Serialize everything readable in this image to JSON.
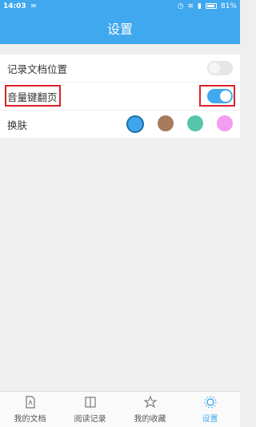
{
  "status": {
    "time": "14:03",
    "battery": "81%"
  },
  "header": {
    "title": "设置"
  },
  "settings": {
    "remember_position": {
      "label": "记录文档位置",
      "on": false
    },
    "volume_page": {
      "label": "音量键翻页",
      "on": true
    },
    "skin": {
      "label": "换肤",
      "colors": [
        "#3ea6ef",
        "#a87a5b",
        "#56c6aa",
        "#f49cef"
      ],
      "selected_index": 0
    }
  },
  "tabs": [
    {
      "label": "我的文档",
      "icon": "document-icon"
    },
    {
      "label": "阅读记录",
      "icon": "book-icon"
    },
    {
      "label": "我的收藏",
      "icon": "star-icon"
    },
    {
      "label": "设置",
      "icon": "gear-icon"
    }
  ],
  "colors": {
    "primary": "#3fa8ee",
    "highlight": "#d9232a"
  }
}
